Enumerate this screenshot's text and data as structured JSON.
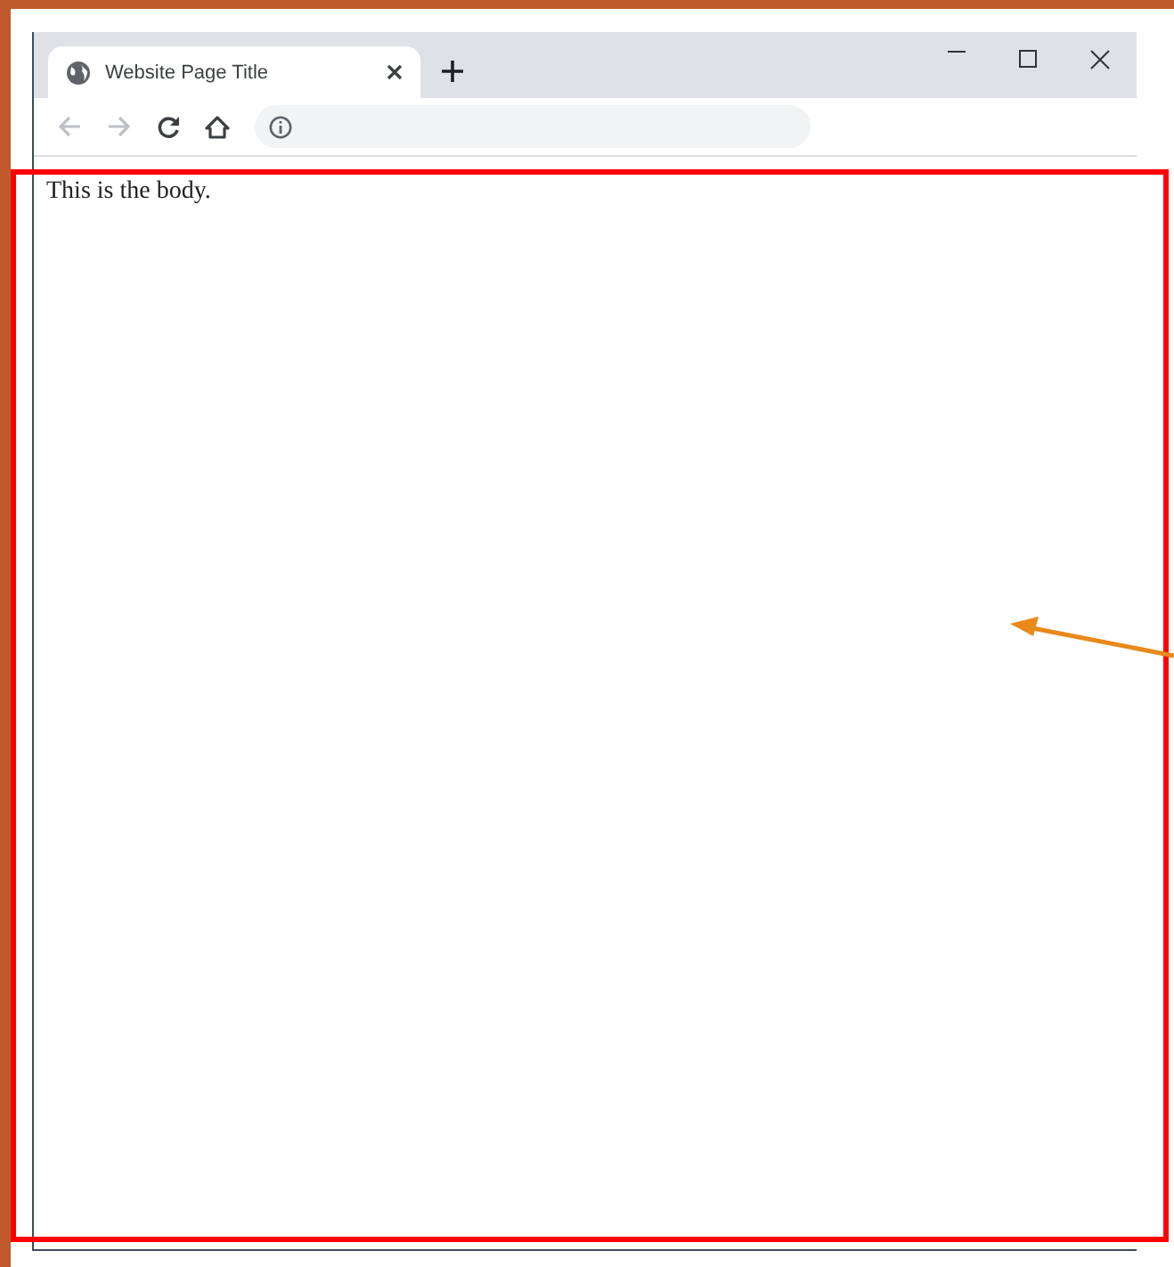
{
  "browser": {
    "tabs": [
      {
        "title": "Website Page Title",
        "selected": true
      }
    ],
    "page": {
      "body_text": "This is the body."
    }
  }
}
